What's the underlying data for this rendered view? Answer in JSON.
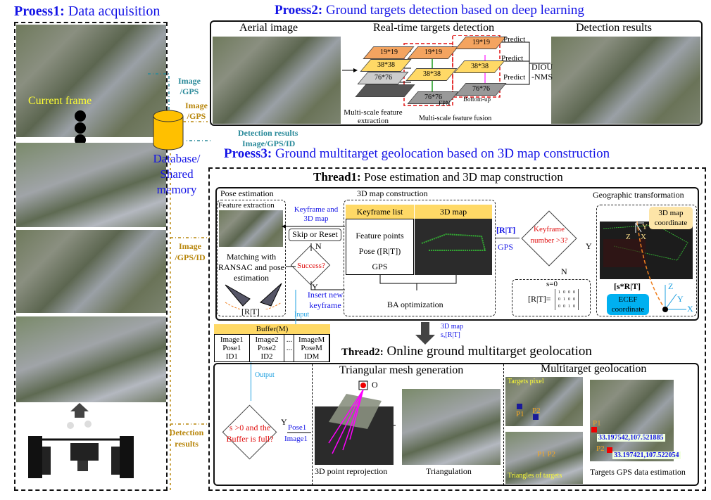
{
  "process1": {
    "label": "Proess1:",
    "title": "Data acquisition",
    "current_frame": "Current frame"
  },
  "database": {
    "label": "Database/ Shared memory",
    "edge_image_gps_1": "Image /GPS",
    "edge_image_gps_2": "Image /GPS",
    "edge_detection": "Detection results",
    "edge_detection_2": "Image/GPS/ID",
    "edge_image_gps_id": "Image /GPS/ID",
    "edge_detection_results": "Detection results"
  },
  "process2": {
    "label": "Proess2:",
    "title": "Ground targets detection based on deep learning",
    "aerial_image": "Aerial image",
    "realtime": "Real-time targets detection",
    "detection_results": "Detection results",
    "layers": [
      "19*19",
      "38*38",
      "76*76"
    ],
    "multi_scale_extraction": "Multi-scale feature extraction",
    "fpn": "FPN",
    "bottom_up": "Bottom-up",
    "fusion": "Multi-scale feature fusion",
    "predict": "Predict",
    "diou": "DIOU -NMS"
  },
  "process3": {
    "label": "Proess3:",
    "title": "Ground multitarget geolocation based on 3D map construction"
  },
  "thread1": {
    "label": "Thread1:",
    "title": "Pose estimation and 3D map construction",
    "pose_estimation": "Pose estimation",
    "feature_extraction": "Feature extraction",
    "matching": "Matching with RANSAC and pose estimation",
    "rt": "[R|T]",
    "keyframe_3dmap": "Keyframe and 3D map",
    "skip_reset": "Skip or Reset",
    "success": "Success?",
    "n": "N",
    "y": "Y",
    "insert": "Insert new keyframe",
    "input": "Input",
    "map_construction": "3D map construction",
    "keyframe_list": "Keyframe list",
    "map3d": "3D map",
    "list_items": [
      "Feature points",
      "Pose ([R|T])",
      "GPS"
    ],
    "ba": "BA optimization",
    "rt_edge": "[R|T]",
    "gps_edge": "GPS",
    "keyframe_number": "Keyframe number >3?",
    "s0": "s=0",
    "rt_eq": "[R|T]=",
    "matrix": [
      [
        "1",
        "0",
        "0",
        "0"
      ],
      [
        "0",
        "1",
        "0",
        "0"
      ],
      [
        "0",
        "0",
        "1",
        "0"
      ]
    ],
    "geo": "Geographic transformation",
    "map_coord": "3D map coordinate",
    "srt": "[s*R|T]",
    "ecef": "ECEF coordinate",
    "axes": [
      "X",
      "Y",
      "Z"
    ]
  },
  "handoff": {
    "label1": "3D map",
    "label2": "s,[R|T]"
  },
  "buffer": {
    "title": "Buffer(M)",
    "cols": [
      [
        "Image1",
        "Pose1",
        "ID1"
      ],
      [
        "Image2",
        "Pose2",
        "ID2"
      ],
      [
        "...",
        "..."
      ],
      [
        "ImageM",
        "PoseM",
        "IDM"
      ]
    ],
    "output": "Output"
  },
  "thread2": {
    "label": "Thread2:",
    "title": "Online ground multitarget geolocation",
    "condition": "s >0 and the Buffer is full?",
    "y": "Y",
    "pose1": "Pose1",
    "image1": "Image1",
    "mesh": "Triangular mesh generation",
    "o": "O",
    "reprojection": "3D point reprojection",
    "triangulation": "Triangulation",
    "geoloc": "Multitarget geolocation",
    "targets_pixel": "Targets pixel",
    "p1": "P1",
    "p2": "P2",
    "triangles": "Triangles of targets",
    "gps1": "33.197542,107.521885",
    "gps2": "33.197421,107.522054",
    "gps_estimation": "Targets GPS data estimation"
  },
  "colors": {
    "title_blue": "#1414e6",
    "teal": "#2a8a9a",
    "gold": "#b8860b",
    "yellow": "#ffd966",
    "cylinder": "#ffc000",
    "ecef": "#00b0f0"
  }
}
